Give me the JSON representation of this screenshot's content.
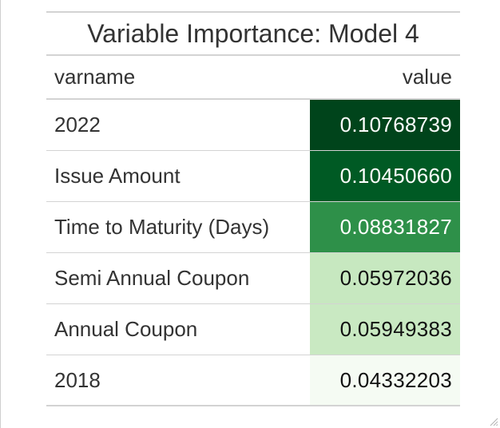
{
  "table": {
    "title": "Variable Importance: Model 4",
    "columns": [
      "varname",
      "value"
    ],
    "rows": [
      {
        "varname": "2022",
        "value": "0.10768739",
        "bg": "#00441b",
        "fg": "#ffffff"
      },
      {
        "varname": "Issue Amount",
        "value": "0.10450660",
        "bg": "#005a24",
        "fg": "#ffffff"
      },
      {
        "varname": "Time to Maturity (Days)",
        "value": "0.08831827",
        "bg": "#2e9049",
        "fg": "#ffffff"
      },
      {
        "varname": "Semi Annual Coupon",
        "value": "0.05972036",
        "bg": "#c7e8c0",
        "fg": "#111111"
      },
      {
        "varname": "Annual Coupon",
        "value": "0.05949383",
        "bg": "#c9e9c2",
        "fg": "#111111"
      },
      {
        "varname": "2018",
        "value": "0.04332203",
        "bg": "#f5fbf3",
        "fg": "#111111"
      }
    ]
  },
  "icons": {
    "resize": "resize-grip-icon"
  }
}
